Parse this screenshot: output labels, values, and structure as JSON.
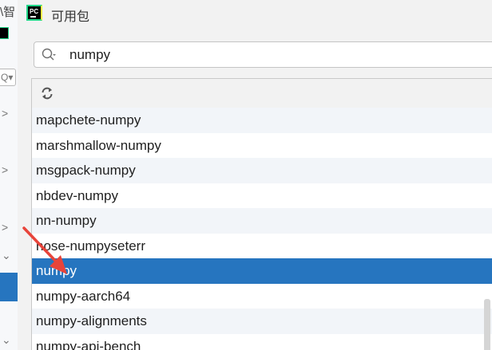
{
  "background_window": {
    "title_fragment": "\\智",
    "search_icon_text": "Q▾",
    "chevrons": [
      ">",
      ">",
      ">",
      "⌄",
      "⌄"
    ]
  },
  "dialog": {
    "title": "可用包",
    "logo_text": "PC"
  },
  "search": {
    "value": "numpy",
    "icon": "search-icon"
  },
  "toolbar": {
    "refresh_icon": "refresh-icon"
  },
  "packages": [
    {
      "name": "mapchete-numpy"
    },
    {
      "name": "marshmallow-numpy"
    },
    {
      "name": "msgpack-numpy"
    },
    {
      "name": "nbdev-numpy"
    },
    {
      "name": "nn-numpy"
    },
    {
      "name": "nose-numpyseterr"
    },
    {
      "name": "numpy",
      "selected": true
    },
    {
      "name": "numpy-aarch64"
    },
    {
      "name": "numpy-alignments"
    },
    {
      "name": "numpy-api-bench"
    }
  ],
  "colors": {
    "selection": "#2675bf",
    "annotation_arrow": "#e8443a",
    "alt_row": "#f2f5f9"
  }
}
